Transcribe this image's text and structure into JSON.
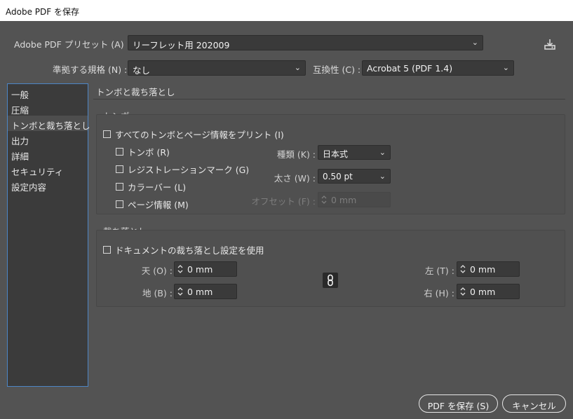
{
  "window": {
    "title": "Adobe PDF を保存"
  },
  "preset": {
    "label": "Adobe PDF プリセット (A) :",
    "value": "リーフレット用 202009"
  },
  "standard": {
    "label": "準拠する規格 (N) :",
    "value": "なし"
  },
  "compat": {
    "label": "互換性 (C) :",
    "value": "Acrobat 5 (PDF 1.4)"
  },
  "sidebar": {
    "items": [
      {
        "label": "一般"
      },
      {
        "label": "圧縮"
      },
      {
        "label": "トンボと裁ち落とし"
      },
      {
        "label": "出力"
      },
      {
        "label": "詳細"
      },
      {
        "label": "セキュリティ"
      },
      {
        "label": "設定内容"
      }
    ]
  },
  "page": {
    "title": "トンボと裁ち落とし"
  },
  "marks": {
    "group_label": "トンボ",
    "all_marks": "すべてのトンボとページ情報をプリント (I)",
    "trim_marks": "トンボ (R)",
    "registration_marks": "レジストレーションマーク (G)",
    "color_bars": "カラーバー (L)",
    "page_info": "ページ情報 (M)",
    "type_label": "種類 (K) :",
    "type_value": "日本式",
    "weight_label": "太さ (W) :",
    "weight_value": "0.50 pt",
    "offset_label": "オフセット (F) :",
    "offset_value": "0 mm"
  },
  "bleed": {
    "group_label": "裁ち落とし",
    "use_doc": "ドキュメントの裁ち落とし設定を使用",
    "top_label": "天 (O) :",
    "top_value": "0 mm",
    "bottom_label": "地 (B) :",
    "bottom_value": "0 mm",
    "left_label": "左 (T) :",
    "left_value": "0 mm",
    "right_label": "右 (H) :",
    "right_value": "0 mm"
  },
  "buttons": {
    "save": "PDF を保存 (S)",
    "cancel": "キャンセル"
  },
  "colors": {
    "bg": "#535353",
    "field": "#3a3a3a",
    "accent": "#4d86c6"
  }
}
